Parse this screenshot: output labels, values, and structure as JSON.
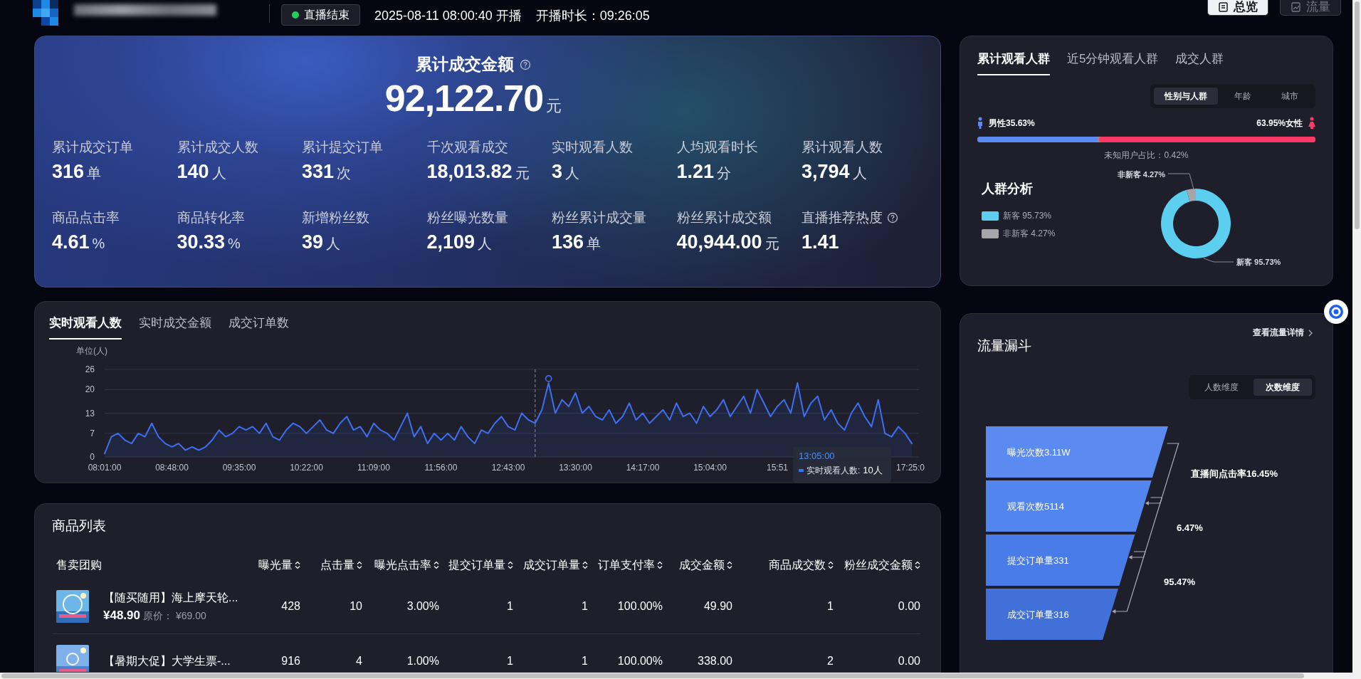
{
  "header": {
    "status": "直播结束",
    "start_time": "2025-08-11 08:00:40 开播",
    "duration": "开播时长：09:26:05",
    "buttons": [
      {
        "label": "总览",
        "selected": true
      },
      {
        "label": "流量",
        "selected": false
      }
    ]
  },
  "summary": {
    "title": "累计成交金额",
    "value": "92,122.70",
    "unit": "元",
    "metrics": [
      {
        "label": "累计成交订单",
        "value": "316",
        "unit": "单",
        "help_icon": false
      },
      {
        "label": "累计成交人数",
        "value": "140",
        "unit": "人",
        "help_icon": false
      },
      {
        "label": "累计提交订单",
        "value": "331",
        "unit": "次",
        "help_icon": false
      },
      {
        "label": "千次观看成交",
        "value": "18,013.82",
        "unit": "元",
        "help_icon": false
      },
      {
        "label": "实时观看人数",
        "value": "3",
        "unit": "人",
        "help_icon": false
      },
      {
        "label": "人均观看时长",
        "value": "1.21",
        "unit": "分",
        "help_icon": false
      },
      {
        "label": "累计观看人数",
        "value": "3,794",
        "unit": "人",
        "help_icon": false
      },
      {
        "label": "商品点击率",
        "value": "4.61",
        "unit": "%",
        "help_icon": false
      },
      {
        "label": "商品转化率",
        "value": "30.33",
        "unit": "%",
        "help_icon": false
      },
      {
        "label": "新增粉丝数",
        "value": "39",
        "unit": "人",
        "help_icon": false
      },
      {
        "label": "粉丝曝光数量",
        "value": "2,109",
        "unit": "人",
        "help_icon": false
      },
      {
        "label": "粉丝累计成交量",
        "value": "136",
        "unit": "单",
        "help_icon": false
      },
      {
        "label": "粉丝累计成交额",
        "value": "40,944.00",
        "unit": "元",
        "help_icon": false
      },
      {
        "label": "直播推荐热度",
        "value": "1.41",
        "help_icon": true
      }
    ]
  },
  "trend": {
    "tabs": [
      {
        "label": "实时观看人数",
        "selected": true
      },
      {
        "label": "实时成交金额",
        "selected": false
      },
      {
        "label": "成交订单数",
        "selected": false
      }
    ],
    "chart_data": {
      "type": "area",
      "ylabel": "单位(人)",
      "ylim": [
        0,
        26
      ],
      "yticks": [
        0,
        7,
        13,
        20,
        26
      ],
      "grid": true,
      "categories": [
        "08:01:00",
        null,
        null,
        null,
        null,
        null,
        null,
        null,
        null,
        null,
        "08:48:00",
        null,
        null,
        null,
        null,
        null,
        null,
        null,
        null,
        null,
        "09:35:00",
        null,
        null,
        null,
        null,
        null,
        null,
        null,
        null,
        null,
        "10:22:00",
        null,
        null,
        null,
        null,
        null,
        null,
        null,
        null,
        null,
        "11:09:00",
        null,
        null,
        null,
        null,
        null,
        null,
        null,
        null,
        null,
        "11:56:00",
        null,
        null,
        null,
        null,
        null,
        null,
        null,
        null,
        null,
        "12:43:00",
        null,
        null,
        null,
        null,
        null,
        null,
        null,
        null,
        null,
        "13:30:00",
        null,
        null,
        null,
        null,
        null,
        null,
        null,
        null,
        null,
        "14:17:00",
        null,
        null,
        null,
        null,
        null,
        null,
        null,
        null,
        null,
        "15:04:00",
        null,
        null,
        null,
        null,
        null,
        null,
        null,
        null,
        null,
        "15:51",
        null,
        null,
        null,
        null,
        null,
        null,
        null,
        null,
        null,
        null,
        null,
        null,
        null,
        null,
        null,
        null,
        null,
        null,
        null,
        "17:25:0"
      ],
      "series": [
        {
          "name": "实时观看人数",
          "color": "#3f6ff0",
          "values": [
            1,
            6,
            7,
            5,
            4,
            7,
            6,
            10,
            6,
            4,
            3,
            4,
            2,
            3,
            2,
            3,
            5,
            8,
            6,
            7,
            9,
            8,
            9,
            7,
            10,
            6,
            5,
            8,
            10,
            9,
            7,
            9,
            11,
            8,
            7,
            10,
            12,
            8,
            9,
            6,
            10,
            8,
            7,
            5,
            9,
            13,
            6,
            9,
            4,
            7,
            5,
            7,
            5,
            9,
            6,
            4,
            8,
            7,
            10,
            12,
            9,
            8,
            13,
            11,
            10,
            14,
            22,
            13,
            17,
            15,
            19,
            13,
            15,
            12,
            11,
            14,
            10,
            12,
            16,
            11,
            13,
            10,
            12,
            14,
            11,
            16,
            12,
            13,
            10,
            15,
            12,
            14,
            17,
            12,
            15,
            18,
            13,
            20,
            16,
            12,
            15,
            17,
            13,
            22,
            12,
            16,
            18,
            11,
            14,
            10,
            8,
            13,
            16,
            12,
            9,
            17,
            7,
            6,
            9,
            7,
            4
          ]
        }
      ]
    },
    "hover": {
      "time": "13:05:00",
      "sep": ":",
      "value": "10人"
    }
  },
  "products": {
    "title": "商品列表",
    "product_column": "售卖团购",
    "columns": [
      "曝光量",
      "点击量",
      "曝光点击率",
      "提交订单量",
      "成交订单量",
      "订单支付率",
      "成交金额",
      "商品成交数",
      "粉丝成交金额"
    ],
    "rows": [
      {
        "title": "【随买随用】海上摩天轮...",
        "price": "¥48.90",
        "original_label": "原价：",
        "original_price": "¥69.00",
        "cells": [
          "428",
          "10",
          "3.00%",
          "1",
          "1",
          "100.00%",
          "49.90",
          "1",
          "0.00"
        ]
      },
      {
        "title": "【暑期大促】大学生票-...",
        "cells": [
          "916",
          "4",
          "1.00%",
          "1",
          "1",
          "100.00%",
          "338.00",
          "2",
          "0.00"
        ]
      }
    ]
  },
  "audience": {
    "tabs": [
      {
        "label": "累计观看人群",
        "selected": true
      },
      {
        "label": "近5分钟观看人群",
        "selected": false
      },
      {
        "label": "成交人群",
        "selected": false
      }
    ],
    "segments": [
      {
        "label": "性别与人群",
        "selected": true
      },
      {
        "label": "年龄",
        "selected": false
      },
      {
        "label": "城市",
        "selected": false
      }
    ],
    "male": {
      "label": "男性35.63%",
      "level": 0.3563
    },
    "female": {
      "label": "63.95%女性",
      "level": 0.6395
    },
    "unknown": "未知用户占比：0.42%",
    "analysis_title": "人群分析",
    "legend": [
      {
        "label": "新客 95.73%",
        "color": "#5ccff0"
      },
      {
        "label": "非新客 4.27%",
        "color": "#a6a6aa"
      }
    ],
    "chart_data": {
      "type": "donut",
      "categories": [
        "新客 95.73%",
        "非新客 4.27%"
      ],
      "values": [
        95.73,
        4.27
      ]
    }
  },
  "funnel": {
    "title": "流量漏斗",
    "link": "查看流量详情",
    "segments": [
      {
        "label": "人数维度",
        "selected": false
      },
      {
        "label": "次数维度",
        "selected": true
      }
    ],
    "stages": [
      "曝光次数3.11W",
      "观看次数5114",
      "提交订单量331",
      "成交订单量316"
    ],
    "rates": [
      "直播间点击率16.45%",
      "6.47%",
      "95.47%"
    ]
  }
}
